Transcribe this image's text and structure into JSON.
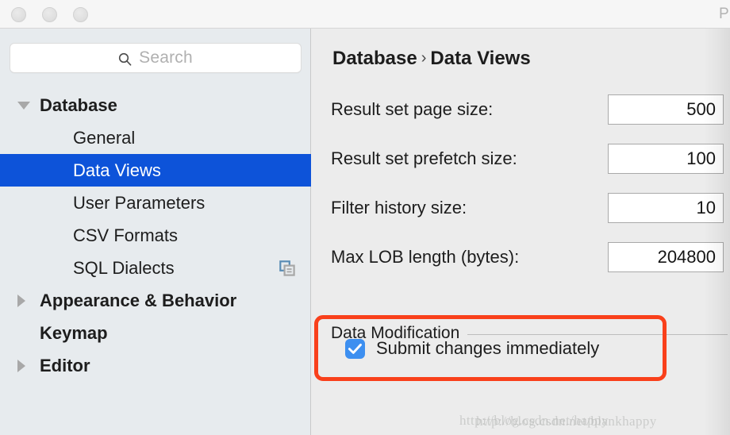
{
  "window": {
    "title_fragment": "P",
    "traffic_lights": [
      "close-button",
      "minimize-button",
      "zoom-button"
    ]
  },
  "search": {
    "placeholder": "Search",
    "value": "",
    "icon": "search-icon"
  },
  "sidebar": {
    "items": [
      {
        "label": "Database",
        "level": "group",
        "twisty": "down",
        "selected": false,
        "trailing_icon": ""
      },
      {
        "label": "General",
        "level": "child",
        "twisty": "none",
        "selected": false,
        "trailing_icon": ""
      },
      {
        "label": "Data Views",
        "level": "child",
        "twisty": "none",
        "selected": true,
        "trailing_icon": ""
      },
      {
        "label": "User Parameters",
        "level": "child",
        "twisty": "none",
        "selected": false,
        "trailing_icon": ""
      },
      {
        "label": "CSV Formats",
        "level": "child",
        "twisty": "none",
        "selected": false,
        "trailing_icon": ""
      },
      {
        "label": "SQL Dialects",
        "level": "child",
        "twisty": "none",
        "selected": false,
        "trailing_icon": "copy-icon"
      },
      {
        "label": "Appearance & Behavior",
        "level": "group",
        "twisty": "right",
        "selected": false,
        "trailing_icon": ""
      },
      {
        "label": "Keymap",
        "level": "group",
        "twisty": "none",
        "selected": false,
        "trailing_icon": ""
      },
      {
        "label": "Editor",
        "level": "group",
        "twisty": "right",
        "selected": false,
        "trailing_icon": ""
      }
    ]
  },
  "panel": {
    "breadcrumb": {
      "parent": "Database",
      "separator": "›",
      "current": "Data Views"
    },
    "fields": [
      {
        "label": "Result set page size:",
        "value": "500"
      },
      {
        "label": "Result set prefetch size:",
        "value": "100"
      },
      {
        "label": "Filter history size:",
        "value": "10"
      },
      {
        "label": "Max LOB length (bytes):",
        "value": "204800"
      }
    ],
    "group": {
      "title": "Data Modification"
    },
    "checkbox": {
      "label": "Submit changes immediately",
      "checked": true
    }
  },
  "annotation": {
    "highlight_color": "#f9401b",
    "target": "submit-changes-immediately-checkbox"
  },
  "watermark": {
    "line_a": "http://blog.csdn.net/happy",
    "line_b": "http://blog.csdn.net/blankhappy"
  },
  "colors": {
    "selection_blue": "#0d53d9",
    "checkbox_blue": "#3d8ff0",
    "sidebar_bg": "#e7ebee",
    "panel_bg": "#ececec",
    "titlebar_bg": "#f6f6f6"
  }
}
